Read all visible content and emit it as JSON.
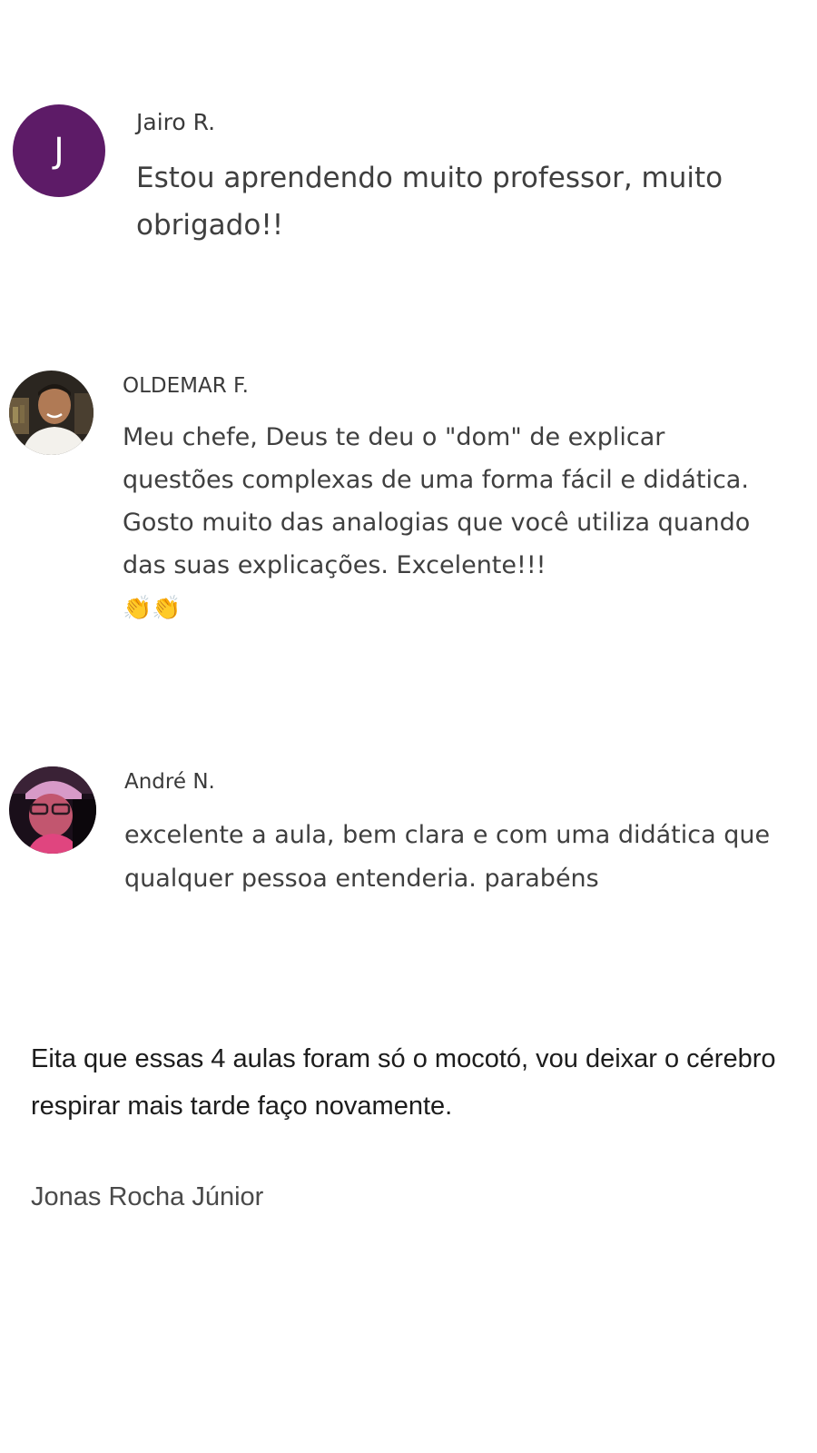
{
  "reviews": [
    {
      "avatar_letter": "J",
      "avatar_color": "#5d1b67",
      "author": "Jairo R.",
      "comment": "Estou aprendendo muito professor, muito obrigado!!"
    },
    {
      "avatar_icon": "user-photo-avatar",
      "author": "OLDEMAR F.",
      "comment": "Meu chefe, Deus te deu o \"dom\" de explicar questões complexas de uma forma fácil e didática. Gosto muito das analogias que você utiliza quando das suas explicações. Excelente!!!",
      "emoji": "👏👏"
    },
    {
      "avatar_icon": "user-photo-avatar",
      "author": "André N.",
      "comment": "excelente a aula, bem clara e com uma didática que qualquer pessoa entenderia. parabéns"
    }
  ],
  "testimonial": {
    "quote": "Eita que essas 4 aulas foram só o mocotó, vou deixar o cérebro respirar mais tarde faço novamente.",
    "author": "Jonas Rocha Júnior"
  }
}
